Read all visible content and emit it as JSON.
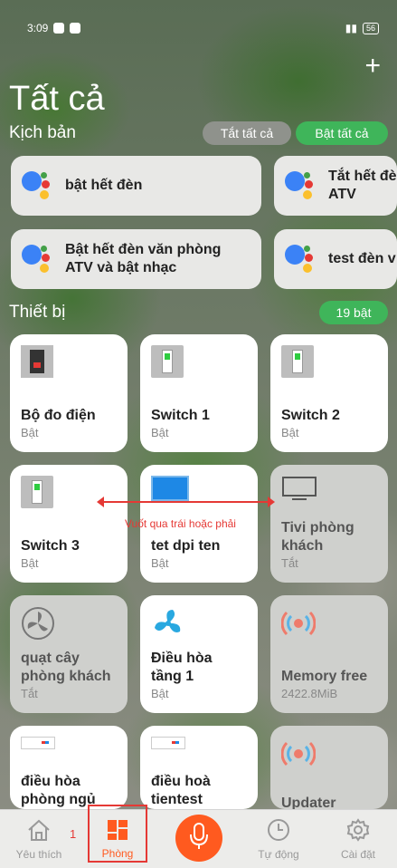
{
  "status_bar": {
    "time": "3:09",
    "battery": "56"
  },
  "header": {
    "title": "Tất cả",
    "add_icon": "plus-icon"
  },
  "scenes": {
    "label": "Kịch bản",
    "off_all": "Tắt tất cả",
    "on_all": "Bật tất cả",
    "items": [
      {
        "label": "bật hết đèn"
      },
      {
        "label_line1": "Tắt hết đè",
        "label_line2": "ATV"
      },
      {
        "label_line1": "Bật hết đèn văn phòng",
        "label_line2": "ATV và bật nhạc"
      },
      {
        "label": "test đèn v"
      }
    ]
  },
  "devices": {
    "label": "Thiết bị",
    "count": "19 bật",
    "items": [
      {
        "name": "Bộ đo điện",
        "state": "Bật",
        "on": true,
        "icon": "power-meter-icon"
      },
      {
        "name": "Switch 1",
        "state": "Bật",
        "on": true,
        "icon": "switch-icon"
      },
      {
        "name": "Switch 2",
        "state": "Bật",
        "on": true,
        "icon": "switch-icon"
      },
      {
        "name": "Switch 3",
        "state": "Bật",
        "on": true,
        "icon": "switch-icon"
      },
      {
        "name": "tet dpi ten",
        "state": "Bật",
        "on": true,
        "icon": "tv-icon"
      },
      {
        "name_line1": "Tivi phòng",
        "name_line2": "khách",
        "state": "Tắt",
        "on": false,
        "icon": "tv-icon"
      },
      {
        "name_line1": "quạt cây",
        "name_line2": "phòng khách",
        "state": "Tắt",
        "on": false,
        "icon": "fan-icon"
      },
      {
        "name_line1": "Điều hòa",
        "name_line2": "tầng 1",
        "state": "Bật",
        "on": true,
        "icon": "fan-icon"
      },
      {
        "name": "Memory free",
        "state": "2422.8MiB",
        "on": false,
        "icon": "sensor-icon"
      },
      {
        "name_line1": "điều hòa",
        "name_line2": "phòng ngủ",
        "on": true,
        "icon": "air-conditioner-icon"
      },
      {
        "name_line1": "điều hoà",
        "name_line2": "tientest",
        "on": true,
        "icon": "air-conditioner-icon"
      },
      {
        "name": "Updater",
        "on": false,
        "icon": "sensor-icon"
      }
    ]
  },
  "annotation": {
    "swipe_hint": "Vuốt qua trái hoặc phải",
    "step": "1"
  },
  "bottom_nav": {
    "favorites": "Yêu thích",
    "rooms": "Phòng",
    "automation": "Tự động",
    "settings": "Cài đặt"
  },
  "colors": {
    "accent": "#ff5a1f",
    "green": "#3fb55a",
    "annotation": "#e53935"
  }
}
